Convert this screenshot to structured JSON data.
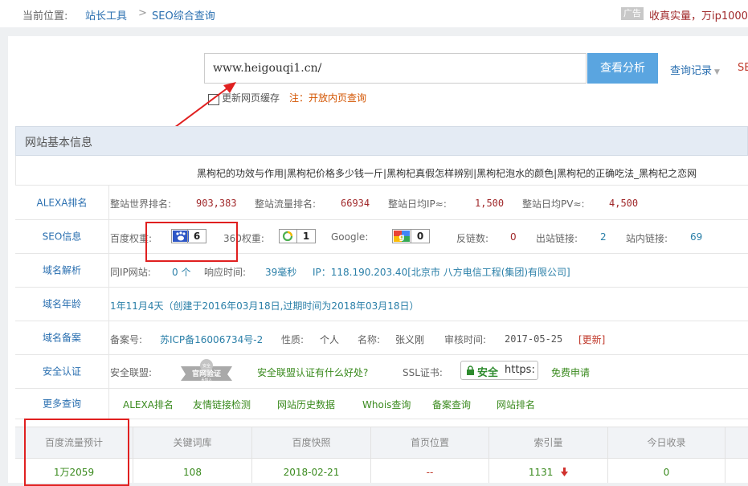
{
  "breadcrumb": {
    "label": "当前位置:",
    "item1": "站长工具",
    "sep": ">",
    "item2": "SEO综合查询"
  },
  "ad": {
    "badge": "广告",
    "text": "收真实量，万ip1000-"
  },
  "search": {
    "value": "www.heigouqi1.cn/",
    "button": "查看分析",
    "history": "查询记录",
    "history_caret": "▼",
    "cut_link": "SE"
  },
  "refresh": {
    "label": "更新网页缓存",
    "note": "注：开放内页查询"
  },
  "panel": {
    "title": "网站基本信息"
  },
  "keywords_line": "黑枸杞的功效与作用|黑枸杞价格多少钱一斤|黑枸杞真假怎样辨别|黑枸杞泡水的颜色|黑枸杞的正确吃法_黑枸杞之恋网",
  "alexa": {
    "label": "ALEXA排名",
    "world_label": "整站世界排名:",
    "world_value": "903,383",
    "traffic_label": "整站流量排名:",
    "traffic_value": "66934",
    "ip_label": "整站日均IP≈:",
    "ip_value": "1,500",
    "pv_label": "整站日均PV≈:",
    "pv_value": "4,500"
  },
  "seo": {
    "label": "SEO信息",
    "baidu_label": "百度权重:",
    "baidu_value": "6",
    "s360_label": "360权重:",
    "s360_value": "1",
    "google_label": "Google:",
    "google_value": "0",
    "backlinks_label": "反链数:",
    "backlinks_value": "0",
    "outlinks_label": "出站链接:",
    "outlinks_value": "2",
    "inlinks_label": "站内链接:",
    "inlinks_value": "69"
  },
  "dns": {
    "label": "域名解析",
    "sameip_label": "同IP网站:",
    "sameip_value": "0 个",
    "resp_label": "响应时间:",
    "resp_value": "39毫秒",
    "ip_text": "IP：118.190.203.40[北京市 八方电信工程(集团)有限公司]"
  },
  "age": {
    "label": "域名年龄",
    "text": "1年11月4天（创建于2016年03月18日,过期时间为2018年03月18日）"
  },
  "icp": {
    "label": "域名备案",
    "no_label": "备案号:",
    "no_value": "苏ICP备16006734号-2",
    "type_label": "性质:",
    "type_value": "个人",
    "name_label": "名称:",
    "name_value": "张义刚",
    "date_label": "审核时间:",
    "date_value": "2017-05-25",
    "update": "[更新]"
  },
  "security": {
    "label": "安全认证",
    "alliance_label": "安全联盟:",
    "seal_top": "安全",
    "seal_main": "官网验证",
    "seal_sub": "未加入",
    "alliance_link": "安全联盟认证有什么好处?",
    "ssl_label": "SSL证书:",
    "ssl_badge_a": "安全",
    "ssl_badge_b": "https:",
    "ssl_link": "免费申请"
  },
  "more": {
    "label": "更多查询",
    "links": [
      "ALEXA排名",
      "友情链接检测",
      "网站历史数据",
      "Whois查询",
      "备案查询",
      "网站排名"
    ]
  },
  "stats": {
    "headers": [
      "百度流量预计",
      "关键词库",
      "百度快照",
      "首页位置",
      "索引量",
      "今日收录"
    ],
    "values": [
      "1万2059",
      "108",
      "2018-02-21",
      "--",
      "1131",
      "0"
    ],
    "index_trend_icon": "down-arrow"
  },
  "colors": {
    "accent": "#5aa5e0",
    "link": "#2a6fb0",
    "value": "#a0282a",
    "annotation": "#e02020"
  }
}
